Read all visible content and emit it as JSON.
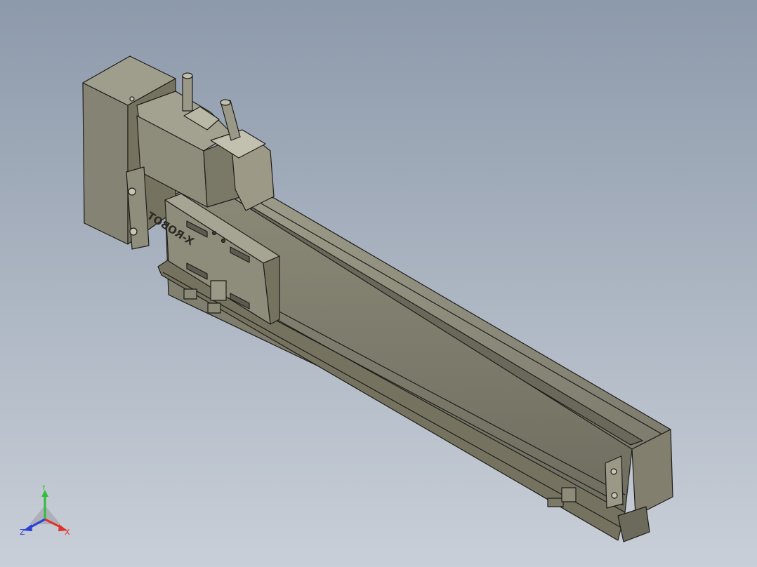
{
  "viewport": {
    "background_top": "#8d9aab",
    "background_bottom": "#c9cfd8"
  },
  "model": {
    "logo_text": "X-ROBOT",
    "body_color": "#8a8878",
    "body_dark": "#5f5d50",
    "body_light": "#a9a795",
    "edge_color": "#1d1d1a"
  },
  "triad": {
    "x_label": "X",
    "y_label": "Y",
    "z_label": "Z",
    "x_color": "#e0302a",
    "y_color": "#2fbf3a",
    "z_color": "#2b3fd6"
  }
}
